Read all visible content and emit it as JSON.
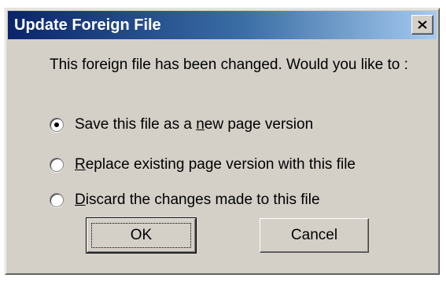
{
  "window": {
    "title": "Update Foreign File",
    "close_icon": "close-icon"
  },
  "message": "This foreign file has been changed. Would you like to :",
  "options": [
    {
      "pre": "Save this file as a ",
      "mnemonic": "n",
      "post": "ew page version",
      "selected": true
    },
    {
      "pre": "",
      "mnemonic": "R",
      "post": "eplace existing page version with this file",
      "selected": false
    },
    {
      "pre": "",
      "mnemonic": "D",
      "post": "iscard the changes made to this file",
      "selected": false
    }
  ],
  "buttons": {
    "ok_label": "OK",
    "cancel_label": "Cancel"
  }
}
